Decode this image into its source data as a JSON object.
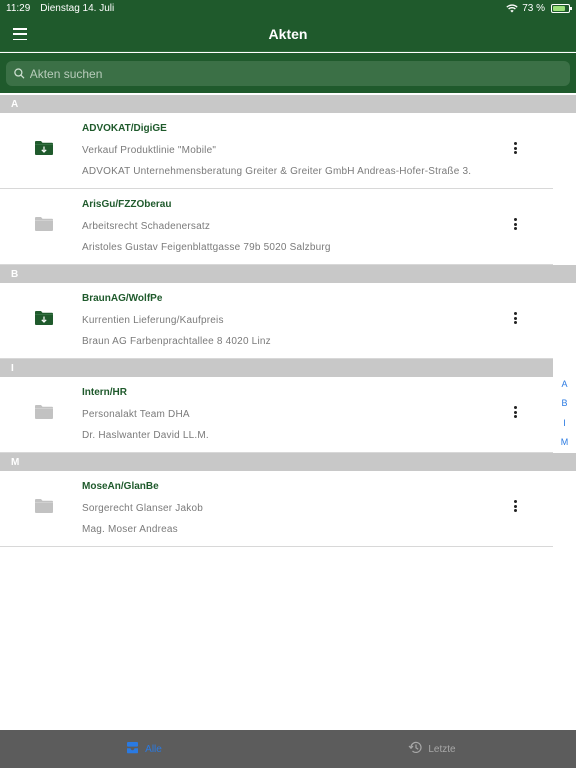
{
  "status": {
    "time": "11:29",
    "date": "Dienstag 14. Juli",
    "battery": "73 %"
  },
  "header": {
    "title": "Akten"
  },
  "search": {
    "placeholder": "Akten suchen"
  },
  "sections": [
    {
      "letter": "A",
      "items": [
        {
          "code": "ADVOKAT/DigiGE",
          "description": "Verkauf Produktlinie \"Mobile\"",
          "address": "ADVOKAT Unternehmensberatung Greiter & Greiter GmbH Andreas-Hofer-Straße 3...",
          "downloaded": true
        },
        {
          "code": "ArisGu/FZZOberau",
          "description": "Arbeitsrecht Schadenersatz",
          "address": "Aristoles Gustav Feigenblattgasse 79b 5020 Salzburg",
          "downloaded": false
        }
      ]
    },
    {
      "letter": "B",
      "items": [
        {
          "code": "BraunAG/WolfPe",
          "description": "Kurrentien Lieferung/Kaufpreis",
          "address": "Braun AG Farbenprachtallee 8 4020 Linz",
          "downloaded": true
        }
      ]
    },
    {
      "letter": "I",
      "items": [
        {
          "code": "Intern/HR",
          "description": "Personalakt Team DHA",
          "address": "Dr. Haslwanter David LL.M.",
          "downloaded": false
        }
      ]
    },
    {
      "letter": "M",
      "items": [
        {
          "code": "MoseAn/GlanBe",
          "description": "Sorgerecht Glanser Jakob",
          "address": "Mag. Moser Andreas",
          "downloaded": false
        }
      ]
    }
  ],
  "index": [
    "A",
    "B",
    "I",
    "M"
  ],
  "tabs": [
    {
      "label": "Alle",
      "icon": "tray-stack-icon",
      "active": true
    },
    {
      "label": "Letzte",
      "icon": "history-clock-icon",
      "active": false
    }
  ],
  "colors": {
    "brand": "#1f5a2c",
    "accent": "#2a7ae2",
    "section": "#c8c8c8"
  }
}
